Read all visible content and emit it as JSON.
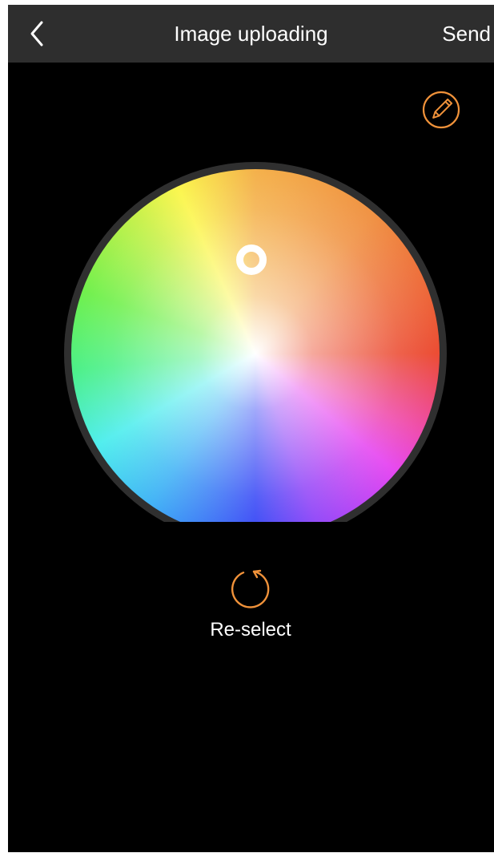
{
  "nav": {
    "title": "Image uploading",
    "send_label": "Send",
    "back_icon": "chevron-left-icon"
  },
  "toolbar": {
    "edit_icon": "pencil-icon"
  },
  "color_wheel": {
    "handle": "selector-ring"
  },
  "reselect": {
    "label": "Re-select",
    "icon": "refresh-icon"
  },
  "colors": {
    "accent": "#F0923A",
    "nav_background": "#2E2E2E",
    "background": "#000000",
    "text": "#FFFFFF"
  }
}
